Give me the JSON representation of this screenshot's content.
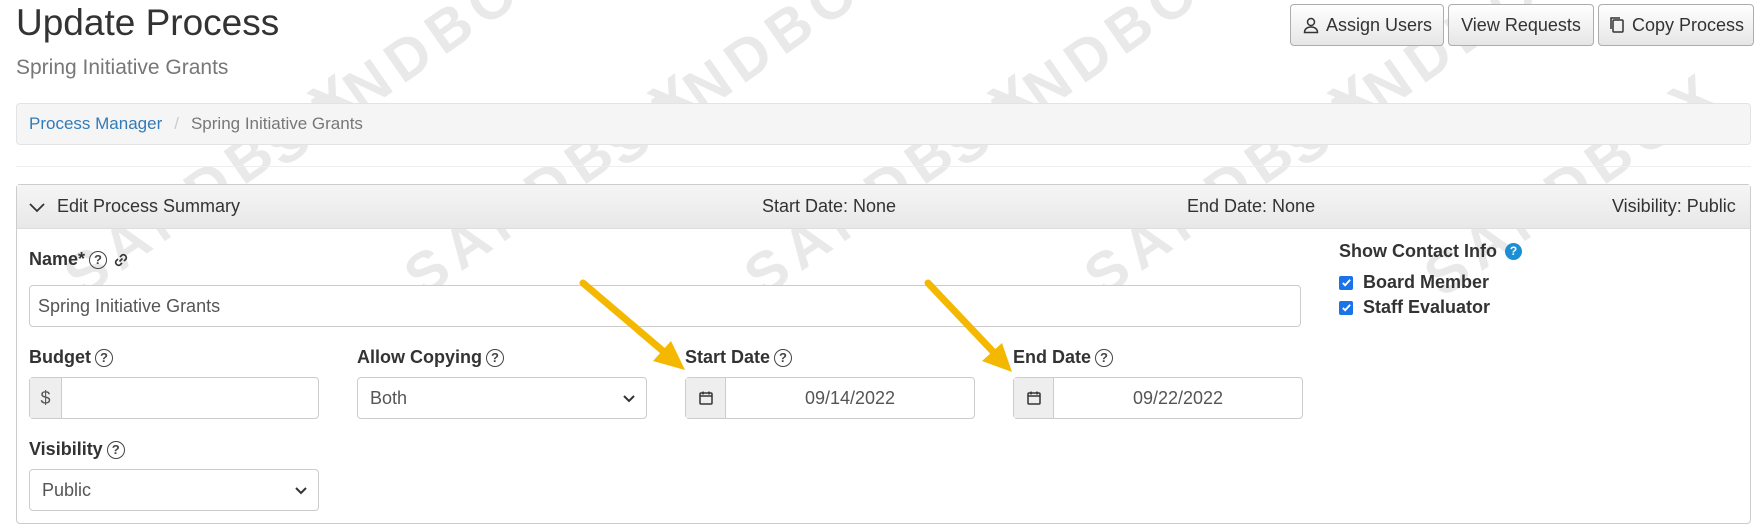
{
  "header": {
    "title": "Update Process",
    "subtitle": "Spring Initiative Grants",
    "buttons": {
      "assign_users": "Assign Users",
      "view_requests": "View Requests",
      "copy_process": "Copy Process"
    }
  },
  "watermark": "SANDBOX",
  "breadcrumb": {
    "root": "Process Manager",
    "current": "Spring Initiative Grants"
  },
  "panel": {
    "title": "Edit Process Summary",
    "start_date_summary": "Start Date: None",
    "end_date_summary": "End Date: None",
    "visibility_summary": "Visibility: Public"
  },
  "form": {
    "name": {
      "label": "Name*",
      "value": "Spring Initiative Grants"
    },
    "budget": {
      "label": "Budget",
      "prefix": "$",
      "value": ""
    },
    "allow_copying": {
      "label": "Allow Copying",
      "value": "Both"
    },
    "start_date": {
      "label": "Start Date",
      "value": "09/14/2022"
    },
    "end_date": {
      "label": "End Date",
      "value": "09/22/2022"
    },
    "visibility": {
      "label": "Visibility",
      "value": "Public"
    }
  },
  "contact_info": {
    "label": "Show Contact Info",
    "items": [
      {
        "label": "Board Member",
        "checked": true
      },
      {
        "label": "Staff Evaluator",
        "checked": true
      }
    ]
  },
  "colors": {
    "link": "#337ab7",
    "checkbox": "#1a73e8",
    "help_icon": "#1a8fd6",
    "annotation_arrow": "#f5b800"
  }
}
